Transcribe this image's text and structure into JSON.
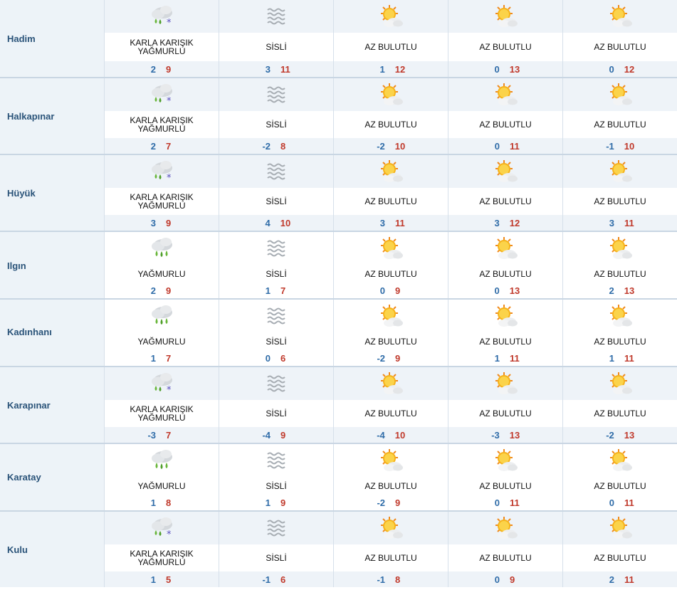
{
  "colors": {
    "row_separator": "#c9d6e3",
    "name_background": "#edf3f8",
    "name_text": "#2a5379",
    "min_temp": "#2f6ca8",
    "max_temp": "#c0392b"
  },
  "rows": [
    {
      "name": "Hadim",
      "days": [
        {
          "icon": "sleet-icon",
          "condition": "KARLA KARIŞIK YAĞMURLU",
          "min": "2",
          "max": "9"
        },
        {
          "icon": "fog-icon",
          "condition": "SİSLİ",
          "min": "3",
          "max": "11"
        },
        {
          "icon": "partly-cloudy-sun-icon",
          "condition": "AZ BULUTLU",
          "min": "1",
          "max": "12"
        },
        {
          "icon": "partly-cloudy-sun-icon",
          "condition": "AZ BULUTLU",
          "min": "0",
          "max": "13"
        },
        {
          "icon": "partly-cloudy-sun-icon",
          "condition": "AZ BULUTLU",
          "min": "0",
          "max": "12"
        }
      ]
    },
    {
      "name": "Halkapınar",
      "days": [
        {
          "icon": "sleet-icon",
          "condition": "KARLA KARIŞIK YAĞMURLU",
          "min": "2",
          "max": "7"
        },
        {
          "icon": "fog-icon",
          "condition": "SİSLİ",
          "min": "-2",
          "max": "8"
        },
        {
          "icon": "partly-cloudy-sun-icon",
          "condition": "AZ BULUTLU",
          "min": "-2",
          "max": "10"
        },
        {
          "icon": "partly-cloudy-sun-icon",
          "condition": "AZ BULUTLU",
          "min": "0",
          "max": "11"
        },
        {
          "icon": "partly-cloudy-sun-icon",
          "condition": "AZ BULUTLU",
          "min": "-1",
          "max": "10"
        }
      ]
    },
    {
      "name": "Hüyük",
      "days": [
        {
          "icon": "sleet-icon",
          "condition": "KARLA KARIŞIK YAĞMURLU",
          "min": "3",
          "max": "9"
        },
        {
          "icon": "fog-icon",
          "condition": "SİSLİ",
          "min": "4",
          "max": "10"
        },
        {
          "icon": "partly-cloudy-sun-icon",
          "condition": "AZ BULUTLU",
          "min": "3",
          "max": "11"
        },
        {
          "icon": "partly-cloudy-sun-icon",
          "condition": "AZ BULUTLU",
          "min": "3",
          "max": "12"
        },
        {
          "icon": "partly-cloudy-sun-icon",
          "condition": "AZ BULUTLU",
          "min": "3",
          "max": "11"
        }
      ]
    },
    {
      "name": "Ilgın",
      "days": [
        {
          "icon": "rain-icon",
          "condition": "YAĞMURLU",
          "min": "2",
          "max": "9"
        },
        {
          "icon": "fog-icon",
          "condition": "SİSLİ",
          "min": "1",
          "max": "7"
        },
        {
          "icon": "partly-cloudy-sun-icon",
          "condition": "AZ BULUTLU",
          "min": "0",
          "max": "9"
        },
        {
          "icon": "partly-cloudy-sun-icon",
          "condition": "AZ BULUTLU",
          "min": "0",
          "max": "13"
        },
        {
          "icon": "partly-cloudy-sun-icon",
          "condition": "AZ BULUTLU",
          "min": "2",
          "max": "13"
        }
      ]
    },
    {
      "name": "Kadınhanı",
      "days": [
        {
          "icon": "rain-icon",
          "condition": "YAĞMURLU",
          "min": "1",
          "max": "7"
        },
        {
          "icon": "fog-icon",
          "condition": "SİSLİ",
          "min": "0",
          "max": "6"
        },
        {
          "icon": "partly-cloudy-sun-icon",
          "condition": "AZ BULUTLU",
          "min": "-2",
          "max": "9"
        },
        {
          "icon": "partly-cloudy-sun-icon",
          "condition": "AZ BULUTLU",
          "min": "1",
          "max": "11"
        },
        {
          "icon": "partly-cloudy-sun-icon",
          "condition": "AZ BULUTLU",
          "min": "1",
          "max": "11"
        }
      ]
    },
    {
      "name": "Karapınar",
      "days": [
        {
          "icon": "sleet-icon",
          "condition": "KARLA KARIŞIK YAĞMURLU",
          "min": "-3",
          "max": "7"
        },
        {
          "icon": "fog-icon",
          "condition": "SİSLİ",
          "min": "-4",
          "max": "9"
        },
        {
          "icon": "partly-cloudy-sun-icon",
          "condition": "AZ BULUTLU",
          "min": "-4",
          "max": "10"
        },
        {
          "icon": "partly-cloudy-sun-icon",
          "condition": "AZ BULUTLU",
          "min": "-3",
          "max": "13"
        },
        {
          "icon": "partly-cloudy-sun-icon",
          "condition": "AZ BULUTLU",
          "min": "-2",
          "max": "13"
        }
      ]
    },
    {
      "name": "Karatay",
      "days": [
        {
          "icon": "rain-icon",
          "condition": "YAĞMURLU",
          "min": "1",
          "max": "8"
        },
        {
          "icon": "fog-icon",
          "condition": "SİSLİ",
          "min": "1",
          "max": "9"
        },
        {
          "icon": "partly-cloudy-sun-icon",
          "condition": "AZ BULUTLU",
          "min": "-2",
          "max": "9"
        },
        {
          "icon": "partly-cloudy-sun-icon",
          "condition": "AZ BULUTLU",
          "min": "0",
          "max": "11"
        },
        {
          "icon": "partly-cloudy-sun-icon",
          "condition": "AZ BULUTLU",
          "min": "0",
          "max": "11"
        }
      ]
    },
    {
      "name": "Kulu",
      "days": [
        {
          "icon": "sleet-icon",
          "condition": "KARLA KARIŞIK YAĞMURLU",
          "min": "1",
          "max": "5"
        },
        {
          "icon": "fog-icon",
          "condition": "SİSLİ",
          "min": "-1",
          "max": "6"
        },
        {
          "icon": "partly-cloudy-sun-icon",
          "condition": "AZ BULUTLU",
          "min": "-1",
          "max": "8"
        },
        {
          "icon": "partly-cloudy-sun-icon",
          "condition": "AZ BULUTLU",
          "min": "0",
          "max": "9"
        },
        {
          "icon": "partly-cloudy-sun-icon",
          "condition": "AZ BULUTLU",
          "min": "2",
          "max": "11"
        }
      ]
    }
  ]
}
